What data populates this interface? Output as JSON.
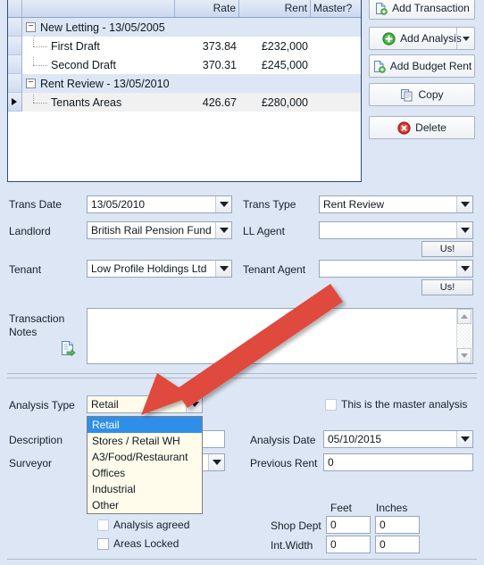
{
  "grid": {
    "columns": [
      "",
      "Rate",
      "Rent",
      "Master?"
    ],
    "rows": [
      {
        "type": "group",
        "label": "New Letting - 13/05/2005",
        "rate": "",
        "rent": "",
        "master": "",
        "expander": "−",
        "selected": false
      },
      {
        "type": "child",
        "label": "First Draft",
        "rate": "373.84",
        "rent": "£232,000",
        "master": "",
        "selected": false
      },
      {
        "type": "child",
        "label": "Second Draft",
        "rate": "370.31",
        "rent": "£245,000",
        "master": "",
        "selected": false
      },
      {
        "type": "group",
        "label": "Rent Review - 13/05/2010",
        "rate": "",
        "rent": "",
        "master": "",
        "expander": "−",
        "selected": false
      },
      {
        "type": "child",
        "label": "Tenants Areas",
        "rate": "426.67",
        "rent": "£280,000",
        "master": "",
        "selected": true
      }
    ]
  },
  "buttons": {
    "add_transaction": "Add Transaction",
    "add_analysis": "Add Analysis",
    "add_budget_rent": "Add Budget Rent",
    "copy": "Copy",
    "delete": "Delete"
  },
  "icons": {
    "add_transaction": "document-add-icon",
    "add_analysis": "green-plus-circle-icon",
    "add_budget_rent": "document-add-icon",
    "copy": "copy-pages-icon",
    "delete": "red-x-circle-icon",
    "notes_export": "document-export-icon",
    "split_caret": "chevron-down-icon"
  },
  "transaction": {
    "trans_date_label": "Trans Date",
    "trans_date_value": "13/05/2010",
    "trans_type_label": "Trans Type",
    "trans_type_value": "Rent Review",
    "landlord_label": "Landlord",
    "landlord_value": "British Rail Pension Fund",
    "ll_agent_label": "LL Agent",
    "ll_agent_value": "",
    "ll_agent_us_button": "Us!",
    "tenant_label": "Tenant",
    "tenant_value": "Low Profile Holdings Ltd",
    "tenant_agent_label": "Tenant Agent",
    "tenant_agent_value": "",
    "tenant_agent_us_button": "Us!",
    "notes_label_line1": "Transaction",
    "notes_label_line2": "Notes",
    "notes_value": ""
  },
  "analysis": {
    "analysis_type_label": "Analysis Type",
    "analysis_type_value": "Retail",
    "analysis_type_options": [
      "Retail",
      "Stores / Retail WH",
      "A3/Food/Restaurant",
      "Offices",
      "Industrial",
      "Other"
    ],
    "analysis_type_selected_index": 0,
    "description_label": "Description",
    "description_value": "",
    "surveyor_label": "Surveyor",
    "surveyor_value": "",
    "master_analysis_label": "This is the master analysis",
    "master_analysis_checked": false,
    "analysis_date_label": "Analysis Date",
    "analysis_date_value": "05/10/2015",
    "previous_rent_label": "Previous Rent",
    "previous_rent_value": "0",
    "analysis_agreed_label": "Analysis agreed",
    "analysis_agreed_checked": false,
    "areas_locked_label": "Areas Locked",
    "areas_locked_checked": false
  },
  "dimensions": {
    "col_feet": "Feet",
    "col_inches": "Inches",
    "rows": [
      {
        "label": "Shop Dept",
        "feet": "0",
        "inches": "0"
      },
      {
        "label": "Int.Width",
        "feet": "0",
        "inches": "0"
      }
    ]
  },
  "annotation": {
    "type": "red-arrow",
    "color": "#e04a3c",
    "points_to": "analysis-type-dropdown"
  }
}
